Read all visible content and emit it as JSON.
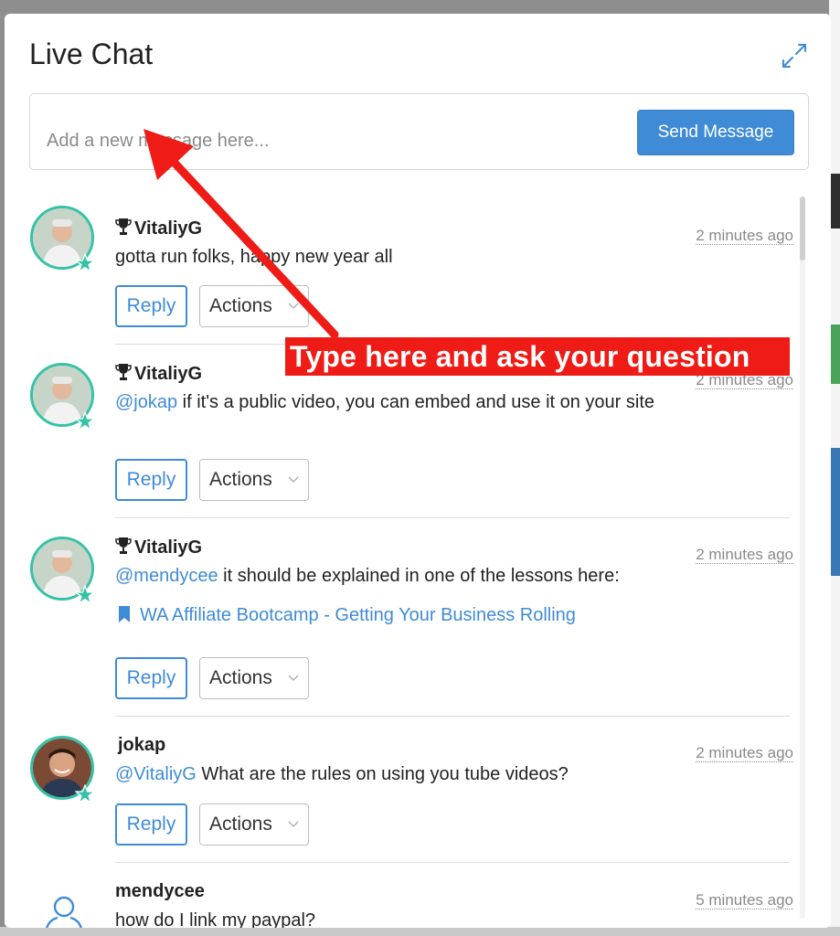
{
  "panel": {
    "title": "Live Chat",
    "expand_icon": "expand-arrows-icon"
  },
  "composer": {
    "placeholder": "Add a new message here...",
    "send_label": "Send Message"
  },
  "messages": [
    {
      "author": "VitaliyG",
      "trophy": true,
      "time": "2 minutes ago",
      "mention": "",
      "text": "gotta run folks, happy new year all",
      "reply_label": "Reply",
      "actions_label": "Actions"
    },
    {
      "author": "VitaliyG",
      "trophy": true,
      "time": "2 minutes ago",
      "mention": "@jokap",
      "text": " if it's a public video, you can embed and use it on your site",
      "reply_label": "Reply",
      "actions_label": "Actions"
    },
    {
      "author": "VitaliyG",
      "trophy": true,
      "time": "2 minutes ago",
      "mention": "@mendycee",
      "text": " it should be explained in one of the lessons here:",
      "link": "WA Affiliate Bootcamp - Getting Your Business Rolling",
      "reply_label": "Reply",
      "actions_label": "Actions"
    },
    {
      "author": "jokap",
      "trophy": false,
      "time": "2 minutes ago",
      "mention": "@VitaliyG",
      "text": " What are the rules on using you tube videos?",
      "reply_label": "Reply",
      "actions_label": "Actions"
    },
    {
      "author": "mendycee",
      "trophy": false,
      "time": "5 minutes ago",
      "mention": "",
      "text": "how do I link my paypal?"
    }
  ],
  "annotation": {
    "label": "Type here and ask your question",
    "color": "#ef1b16"
  },
  "colors": {
    "accent": "#3f8bd6",
    "status_online": "#35c2a6"
  }
}
